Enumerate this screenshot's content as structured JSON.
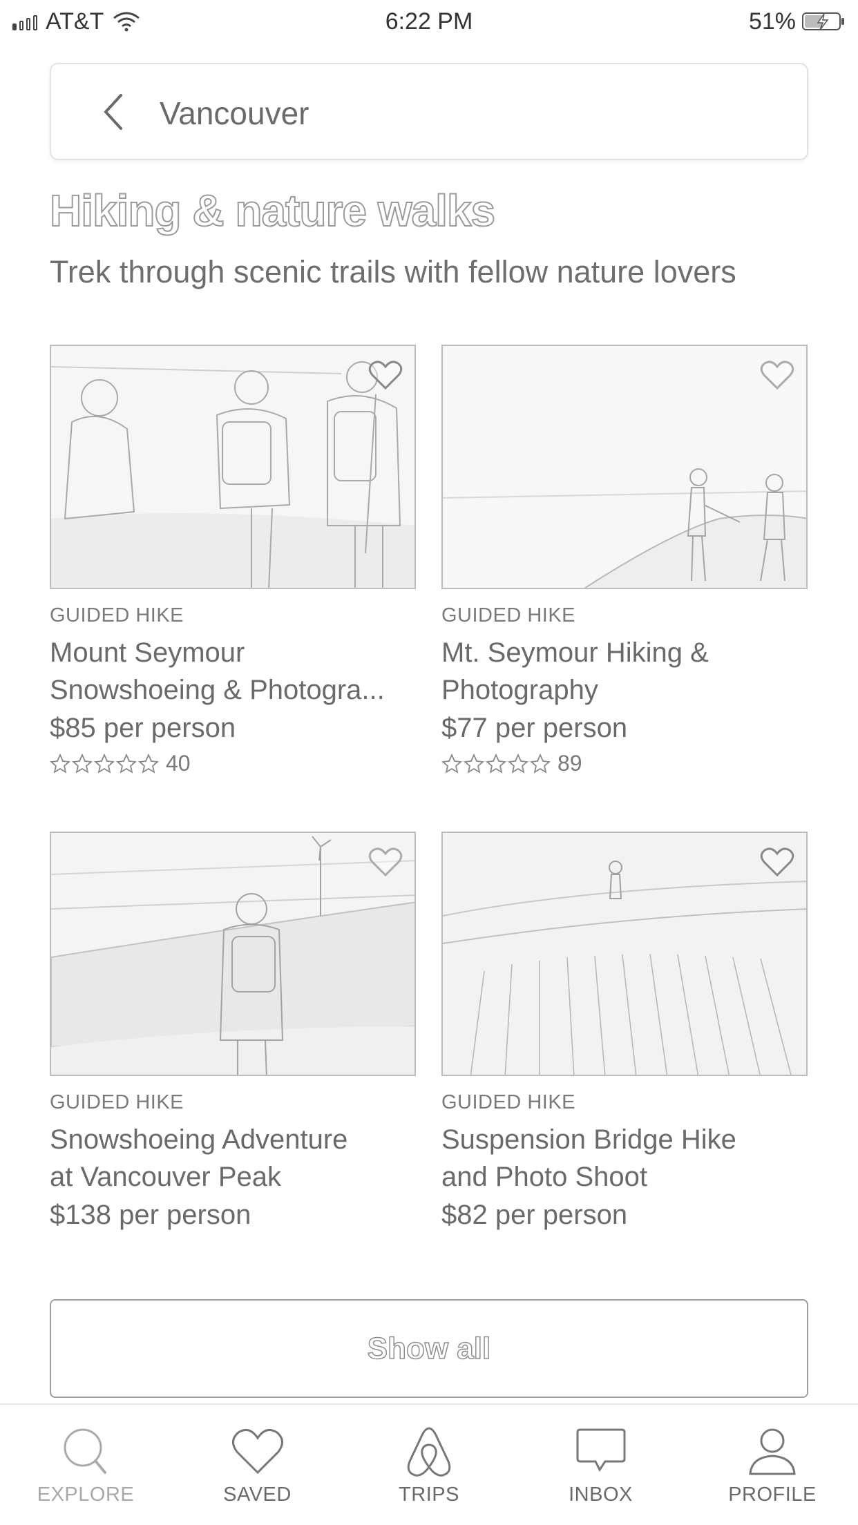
{
  "status_bar": {
    "carrier": "AT&T",
    "time": "6:22 PM",
    "battery": "51%"
  },
  "search": {
    "value": "Vancouver"
  },
  "section": {
    "title": "Hiking & nature walks",
    "subtitle": "Trek through scenic trails with fellow nature lovers"
  },
  "cards": [
    {
      "type": "GUIDED HIKE",
      "title_line1": "Mount Seymour",
      "title_line2": "Snowshoeing & Photogra...",
      "price": "$85 per person",
      "rating_stars": 5,
      "review_count": "40"
    },
    {
      "type": "GUIDED HIKE",
      "title_line1": "Mt. Seymour Hiking &",
      "title_line2": "Photography",
      "price": "$77 per person",
      "rating_stars": 5,
      "review_count": "89"
    },
    {
      "type": "GUIDED HIKE",
      "title_line1": "Snowshoeing Adventure",
      "title_line2": "at Vancouver Peak",
      "price": "$138 per person"
    },
    {
      "type": "GUIDED HIKE",
      "title_line1": "Suspension Bridge Hike",
      "title_line2": "and Photo Shoot",
      "price": "$82 per person"
    }
  ],
  "show_all_label": "Show all",
  "tabs": [
    {
      "label": "EXPLORE",
      "icon": "search-icon",
      "active": true
    },
    {
      "label": "SAVED",
      "icon": "heart-icon"
    },
    {
      "label": "TRIPS",
      "icon": "airbnb-logo-icon"
    },
    {
      "label": "INBOX",
      "icon": "chat-bubble-icon"
    },
    {
      "label": "PROFILE",
      "icon": "person-icon"
    }
  ]
}
